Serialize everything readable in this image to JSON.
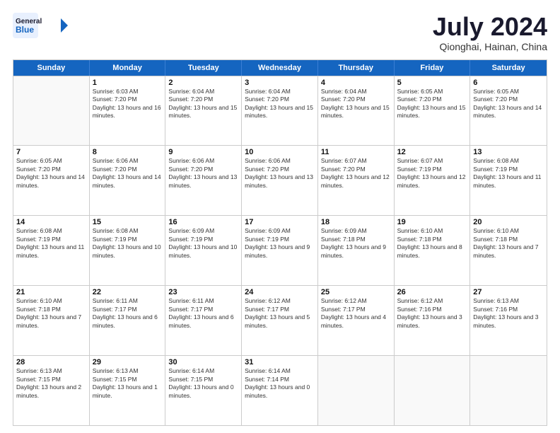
{
  "logo": {
    "line1": "General",
    "line2": "Blue"
  },
  "title": "July 2024",
  "location": "Qionghai, Hainan, China",
  "header_days": [
    "Sunday",
    "Monday",
    "Tuesday",
    "Wednesday",
    "Thursday",
    "Friday",
    "Saturday"
  ],
  "weeks": [
    [
      {
        "day": "",
        "sunrise": "",
        "sunset": "",
        "daylight": ""
      },
      {
        "day": "1",
        "sunrise": "Sunrise: 6:03 AM",
        "sunset": "Sunset: 7:20 PM",
        "daylight": "Daylight: 13 hours and 16 minutes."
      },
      {
        "day": "2",
        "sunrise": "Sunrise: 6:04 AM",
        "sunset": "Sunset: 7:20 PM",
        "daylight": "Daylight: 13 hours and 15 minutes."
      },
      {
        "day": "3",
        "sunrise": "Sunrise: 6:04 AM",
        "sunset": "Sunset: 7:20 PM",
        "daylight": "Daylight: 13 hours and 15 minutes."
      },
      {
        "day": "4",
        "sunrise": "Sunrise: 6:04 AM",
        "sunset": "Sunset: 7:20 PM",
        "daylight": "Daylight: 13 hours and 15 minutes."
      },
      {
        "day": "5",
        "sunrise": "Sunrise: 6:05 AM",
        "sunset": "Sunset: 7:20 PM",
        "daylight": "Daylight: 13 hours and 15 minutes."
      },
      {
        "day": "6",
        "sunrise": "Sunrise: 6:05 AM",
        "sunset": "Sunset: 7:20 PM",
        "daylight": "Daylight: 13 hours and 14 minutes."
      }
    ],
    [
      {
        "day": "7",
        "sunrise": "Sunrise: 6:05 AM",
        "sunset": "Sunset: 7:20 PM",
        "daylight": "Daylight: 13 hours and 14 minutes."
      },
      {
        "day": "8",
        "sunrise": "Sunrise: 6:06 AM",
        "sunset": "Sunset: 7:20 PM",
        "daylight": "Daylight: 13 hours and 14 minutes."
      },
      {
        "day": "9",
        "sunrise": "Sunrise: 6:06 AM",
        "sunset": "Sunset: 7:20 PM",
        "daylight": "Daylight: 13 hours and 13 minutes."
      },
      {
        "day": "10",
        "sunrise": "Sunrise: 6:06 AM",
        "sunset": "Sunset: 7:20 PM",
        "daylight": "Daylight: 13 hours and 13 minutes."
      },
      {
        "day": "11",
        "sunrise": "Sunrise: 6:07 AM",
        "sunset": "Sunset: 7:20 PM",
        "daylight": "Daylight: 13 hours and 12 minutes."
      },
      {
        "day": "12",
        "sunrise": "Sunrise: 6:07 AM",
        "sunset": "Sunset: 7:19 PM",
        "daylight": "Daylight: 13 hours and 12 minutes."
      },
      {
        "day": "13",
        "sunrise": "Sunrise: 6:08 AM",
        "sunset": "Sunset: 7:19 PM",
        "daylight": "Daylight: 13 hours and 11 minutes."
      }
    ],
    [
      {
        "day": "14",
        "sunrise": "Sunrise: 6:08 AM",
        "sunset": "Sunset: 7:19 PM",
        "daylight": "Daylight: 13 hours and 11 minutes."
      },
      {
        "day": "15",
        "sunrise": "Sunrise: 6:08 AM",
        "sunset": "Sunset: 7:19 PM",
        "daylight": "Daylight: 13 hours and 10 minutes."
      },
      {
        "day": "16",
        "sunrise": "Sunrise: 6:09 AM",
        "sunset": "Sunset: 7:19 PM",
        "daylight": "Daylight: 13 hours and 10 minutes."
      },
      {
        "day": "17",
        "sunrise": "Sunrise: 6:09 AM",
        "sunset": "Sunset: 7:19 PM",
        "daylight": "Daylight: 13 hours and 9 minutes."
      },
      {
        "day": "18",
        "sunrise": "Sunrise: 6:09 AM",
        "sunset": "Sunset: 7:18 PM",
        "daylight": "Daylight: 13 hours and 9 minutes."
      },
      {
        "day": "19",
        "sunrise": "Sunrise: 6:10 AM",
        "sunset": "Sunset: 7:18 PM",
        "daylight": "Daylight: 13 hours and 8 minutes."
      },
      {
        "day": "20",
        "sunrise": "Sunrise: 6:10 AM",
        "sunset": "Sunset: 7:18 PM",
        "daylight": "Daylight: 13 hours and 7 minutes."
      }
    ],
    [
      {
        "day": "21",
        "sunrise": "Sunrise: 6:10 AM",
        "sunset": "Sunset: 7:18 PM",
        "daylight": "Daylight: 13 hours and 7 minutes."
      },
      {
        "day": "22",
        "sunrise": "Sunrise: 6:11 AM",
        "sunset": "Sunset: 7:17 PM",
        "daylight": "Daylight: 13 hours and 6 minutes."
      },
      {
        "day": "23",
        "sunrise": "Sunrise: 6:11 AM",
        "sunset": "Sunset: 7:17 PM",
        "daylight": "Daylight: 13 hours and 6 minutes."
      },
      {
        "day": "24",
        "sunrise": "Sunrise: 6:12 AM",
        "sunset": "Sunset: 7:17 PM",
        "daylight": "Daylight: 13 hours and 5 minutes."
      },
      {
        "day": "25",
        "sunrise": "Sunrise: 6:12 AM",
        "sunset": "Sunset: 7:17 PM",
        "daylight": "Daylight: 13 hours and 4 minutes."
      },
      {
        "day": "26",
        "sunrise": "Sunrise: 6:12 AM",
        "sunset": "Sunset: 7:16 PM",
        "daylight": "Daylight: 13 hours and 3 minutes."
      },
      {
        "day": "27",
        "sunrise": "Sunrise: 6:13 AM",
        "sunset": "Sunset: 7:16 PM",
        "daylight": "Daylight: 13 hours and 3 minutes."
      }
    ],
    [
      {
        "day": "28",
        "sunrise": "Sunrise: 6:13 AM",
        "sunset": "Sunset: 7:15 PM",
        "daylight": "Daylight: 13 hours and 2 minutes."
      },
      {
        "day": "29",
        "sunrise": "Sunrise: 6:13 AM",
        "sunset": "Sunset: 7:15 PM",
        "daylight": "Daylight: 13 hours and 1 minute."
      },
      {
        "day": "30",
        "sunrise": "Sunrise: 6:14 AM",
        "sunset": "Sunset: 7:15 PM",
        "daylight": "Daylight: 13 hours and 0 minutes."
      },
      {
        "day": "31",
        "sunrise": "Sunrise: 6:14 AM",
        "sunset": "Sunset: 7:14 PM",
        "daylight": "Daylight: 13 hours and 0 minutes."
      },
      {
        "day": "",
        "sunrise": "",
        "sunset": "",
        "daylight": ""
      },
      {
        "day": "",
        "sunrise": "",
        "sunset": "",
        "daylight": ""
      },
      {
        "day": "",
        "sunrise": "",
        "sunset": "",
        "daylight": ""
      }
    ]
  ]
}
